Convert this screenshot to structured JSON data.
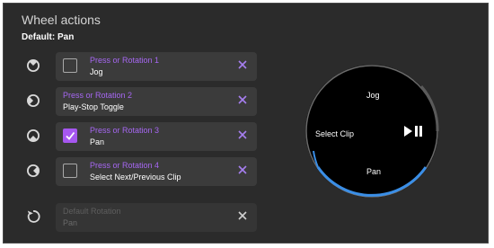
{
  "header": {
    "title": "Wheel actions",
    "subtitle": "Default: Pan"
  },
  "rows": [
    {
      "label": "Press or Rotation 1",
      "value": "Jog",
      "checked": false,
      "has_checkbox": true,
      "icon": "wheel-top-icon"
    },
    {
      "label": "Press or Rotation 2",
      "value": "Play-Stop Toggle",
      "checked": false,
      "has_checkbox": false,
      "icon": "wheel-left-icon"
    },
    {
      "label": "Press or Rotation 3",
      "value": "Pan",
      "checked": true,
      "has_checkbox": true,
      "icon": "wheel-bottom-icon"
    },
    {
      "label": "Press or Rotation 4",
      "value": "Select Next/Previous Clip",
      "checked": false,
      "has_checkbox": true,
      "icon": "wheel-right-icon"
    }
  ],
  "default_row": {
    "label": "Default Rotation",
    "value": "Pan",
    "icon": "rotate-icon"
  },
  "wheel": {
    "top": "Jog",
    "left": "Select Clip",
    "right_icon": "play-pause-icon",
    "bottom": "Pan"
  },
  "colors": {
    "accent": "#a657f0",
    "label": "#a667f2",
    "wheel_arc": "#3a8ee6"
  }
}
